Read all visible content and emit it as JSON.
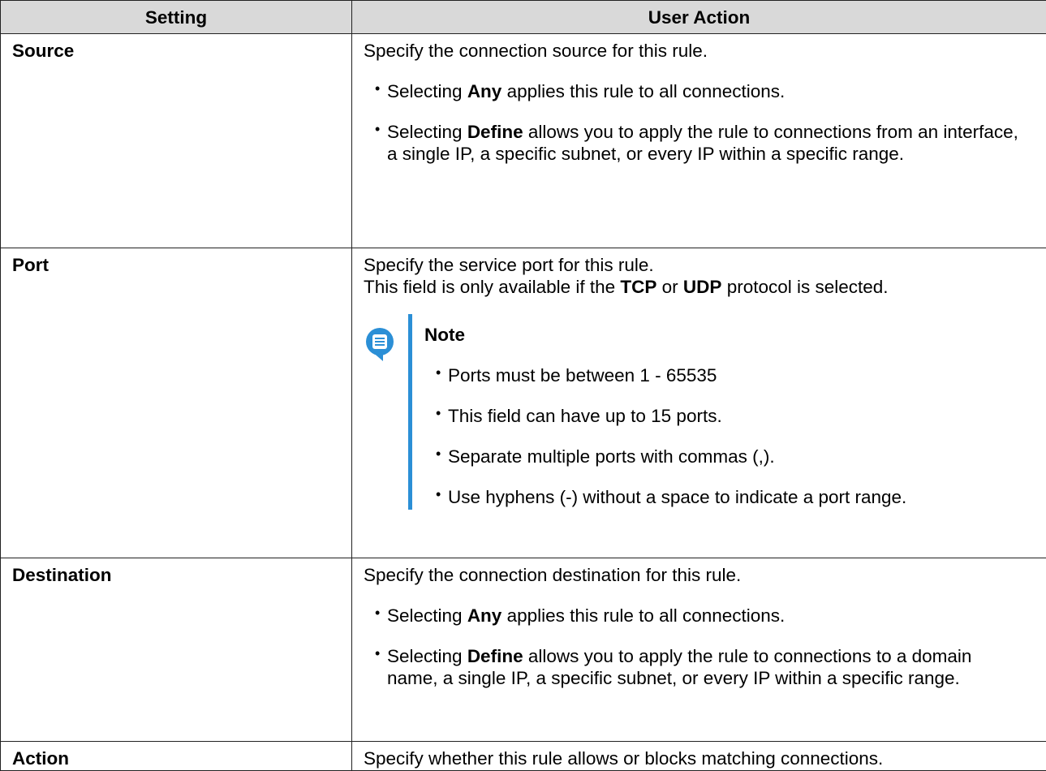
{
  "table": {
    "headers": {
      "setting": "Setting",
      "action": "User Action"
    },
    "rows": {
      "source": {
        "setting": "Source",
        "intro": "Specify the connection source for this rule.",
        "bullet1": {
          "pre": "Selecting ",
          "bold": "Any",
          "post": " applies this rule to all connections."
        },
        "bullet2": {
          "pre": "Selecting ",
          "bold": "Define",
          "post": " allows you to apply the rule to connections from an interface, a single IP, a specific subnet, or every IP within a specific range."
        }
      },
      "port": {
        "setting": "Port",
        "intro": "Specify the service port for this rule.",
        "line2": {
          "pre": "This field is only available if the ",
          "bold1": "TCP",
          "mid": " or ",
          "bold2": "UDP",
          "post": " protocol is selected."
        },
        "note": {
          "icon": "note-icon",
          "icon_color": "#2b8fd6",
          "title": "Note",
          "items": [
            "Ports must be between 1 - 65535",
            "This field can have up to 15 ports.",
            "Separate multiple ports with commas (,).",
            "Use hyphens (-) without a space to indicate a port range."
          ]
        }
      },
      "destination": {
        "setting": "Destination",
        "intro": "Specify the connection destination for this rule.",
        "bullet1": {
          "pre": "Selecting ",
          "bold": "Any",
          "post": " applies this rule to all connections."
        },
        "bullet2": {
          "pre": "Selecting ",
          "bold": "Define",
          "post": " allows you to apply the rule to connections to a domain name, a single IP, a specific subnet, or every IP within a specific range."
        }
      },
      "action": {
        "setting": "Action",
        "intro": "Specify whether this rule allows or blocks matching connections."
      }
    },
    "bullet_glyph": "•",
    "header_bg": "#d9d9d9"
  }
}
